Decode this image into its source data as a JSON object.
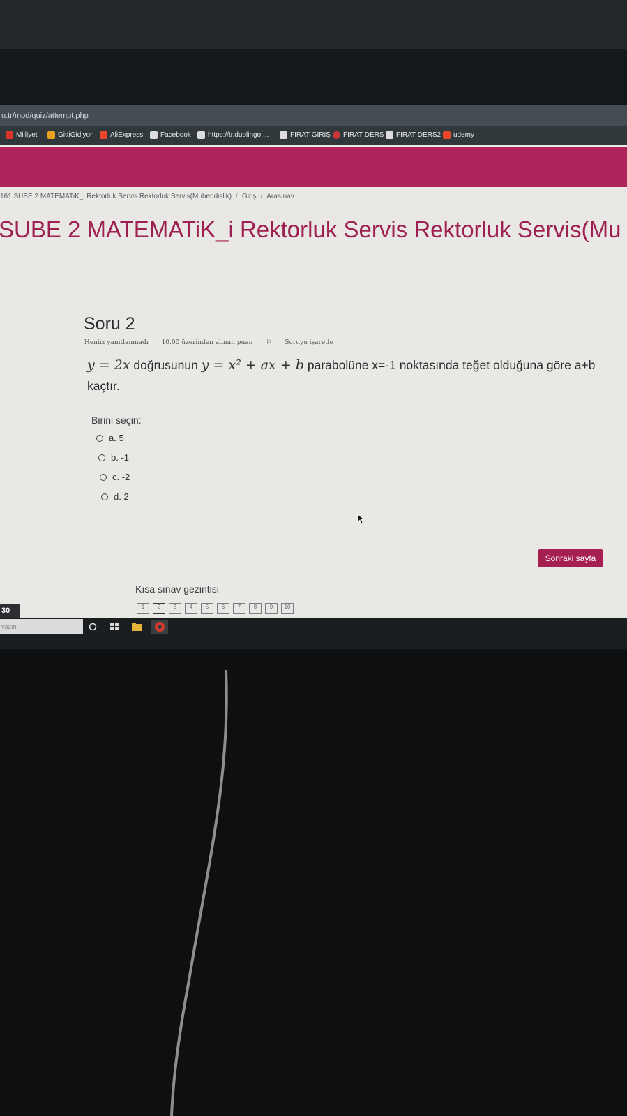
{
  "browser": {
    "url": "u.tr/mod/quiz/attempt.php",
    "bookmarks": [
      {
        "label": "Milliyet",
        "icon": "milliyet-icon",
        "color": "#d9352c"
      },
      {
        "label": "GittiGidiyor",
        "icon": "gittigidiyor-icon",
        "color": "#e8a11f"
      },
      {
        "label": "AliExpress",
        "icon": "aliexpress-icon",
        "color": "#e8452c"
      },
      {
        "label": "Facebook",
        "icon": "page-icon",
        "color": "#dcdcdc"
      },
      {
        "label": "https://tr.duolingo....",
        "icon": "grid-icon",
        "color": "#dcdcdc"
      },
      {
        "label": "FIRAT GİRİŞ",
        "icon": "page-icon",
        "color": "#dcdcdc"
      },
      {
        "label": "FIRAT DERS",
        "icon": "firat-icon",
        "color": "#c8353a"
      },
      {
        "label": "FIRAT DERS2",
        "icon": "page-icon",
        "color": "#dcdcdc"
      },
      {
        "label": "udemy",
        "icon": "udemy-icon",
        "color": "#e8452c"
      }
    ]
  },
  "breadcrumb": {
    "course": "161 SUBE 2 MATEMATiK_i Rektorluk Servis Rektorluk Servis(Muhendislik)",
    "section": "Giriş",
    "page": "Arasınav"
  },
  "course_title": "SUBE 2 MATEMATiK_i Rektorluk Servis Rektorluk Servis(Mu",
  "question": {
    "title": "Soru 2",
    "status": "Henüz yanıtlanmadı",
    "points": "10.00 üzerinden alınan puan",
    "flag_label": "Soruyu işaretle",
    "math_line": "y = 2x",
    "text_a": " doğrusunun ",
    "math_parabola": "y = x² + ax + b",
    "text_b": " parabolüne x=-1 noktasında teğet olduğuna göre a+b kaçtır.",
    "choose_label": "Birini seçin:",
    "options": [
      "a. 5",
      "b. -1",
      "c. -2",
      "d. 2"
    ]
  },
  "next_button": "Sonraki sayfa",
  "quiz_nav": {
    "title": "Kısa sınav gezintisi",
    "pages": [
      "1",
      "2",
      "3",
      "4",
      "5",
      "6",
      "7",
      "8",
      "9",
      "10"
    ],
    "current": "2"
  },
  "taskbar": {
    "badge": "30",
    "search_placeholder": "yazın"
  },
  "colors": {
    "accent": "#b0245e",
    "title": "#9e1f52",
    "button": "#a51f51"
  }
}
